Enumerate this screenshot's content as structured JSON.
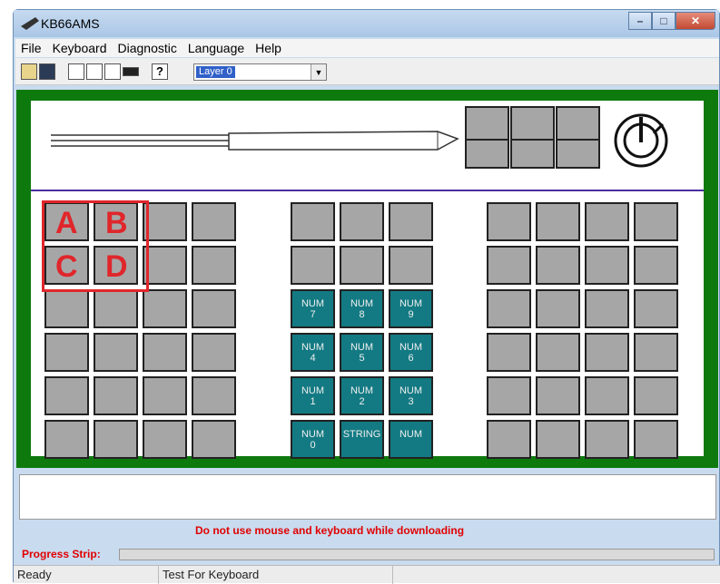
{
  "window": {
    "title": "KB66AMS",
    "close_glyph": "✕",
    "min_glyph": "–",
    "max_glyph": "□"
  },
  "menu": [
    "File",
    "Keyboard",
    "Diagnostic",
    "Language",
    "Help"
  ],
  "toolbar": {
    "icons": [
      "open-icon",
      "save-icon",
      "keyboard-layout-icon",
      "export-icon",
      "eraser-icon",
      "bar-icon",
      "help-icon"
    ],
    "help_glyph": "?",
    "layer": "Layer 0",
    "dropdown_glyph": "▼"
  },
  "keyboard": {
    "left_labels": [
      "A",
      "B",
      "C",
      "D"
    ],
    "numpad": [
      [
        "",
        "",
        " "
      ],
      [
        "",
        "",
        ""
      ],
      [
        "NUM\n7",
        "NUM\n8",
        "NUM\n9"
      ],
      [
        "NUM\n4",
        "NUM\n5",
        "NUM\n6"
      ],
      [
        "NUM\n1",
        "NUM\n2",
        "NUM\n3"
      ],
      [
        "NUM\n0",
        "STRING",
        "NUM"
      ]
    ]
  },
  "status": {
    "warning": "Do not use mouse and keyboard while downloading",
    "progress_label": "Progress Strip:",
    "ready": "Ready",
    "mode": "Test For Keyboard"
  },
  "colors": {
    "frame": "#0e7a0e",
    "num_key": "#137a83",
    "key": "#a6a6a6",
    "alert": "#e0262b"
  }
}
